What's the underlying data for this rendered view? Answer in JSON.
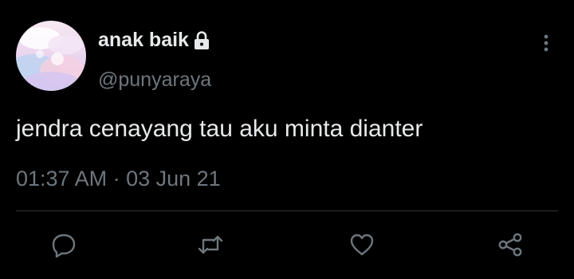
{
  "tweet": {
    "display_name": "anak baik",
    "handle": "@punyaraya",
    "text": "jendra cenayang tau aku minta dianter",
    "time": "01:37 AM",
    "separator": " · ",
    "date": "03 Jun 21"
  },
  "icons": {
    "lock": "lock-icon",
    "more": "more-vertical-icon",
    "reply": "reply-icon",
    "retweet": "retweet-icon",
    "like": "heart-icon",
    "share": "share-icon"
  },
  "colors": {
    "background": "#000000",
    "primary_text": "#e7e9ea",
    "secondary_text": "#6e767d",
    "divider": "#2f3336"
  }
}
